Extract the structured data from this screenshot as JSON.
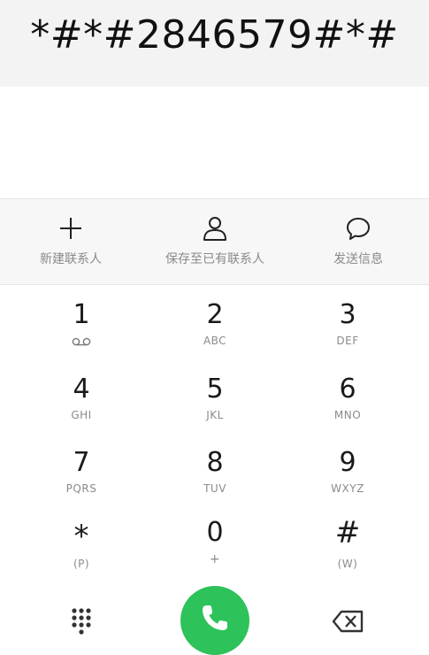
{
  "dialer": {
    "number": "*#*#2846579#*#"
  },
  "actions": [
    {
      "label": "新建联系人",
      "icon": "plus-icon"
    },
    {
      "label": "保存至已有联系人",
      "icon": "person-icon"
    },
    {
      "label": "发送信息",
      "icon": "message-bubble-icon"
    }
  ],
  "keys": [
    {
      "digit": "1",
      "letters": "",
      "icon": "voicemail-icon"
    },
    {
      "digit": "2",
      "letters": "ABC"
    },
    {
      "digit": "3",
      "letters": "DEF"
    },
    {
      "digit": "4",
      "letters": "GHI"
    },
    {
      "digit": "5",
      "letters": "JKL"
    },
    {
      "digit": "6",
      "letters": "MNO"
    },
    {
      "digit": "7",
      "letters": "PQRS"
    },
    {
      "digit": "8",
      "letters": "TUV"
    },
    {
      "digit": "9",
      "letters": "WXYZ"
    },
    {
      "digit": "*",
      "letters": "(P)"
    },
    {
      "digit": "0",
      "letters": "+"
    },
    {
      "digit": "#",
      "letters": "(W)"
    }
  ],
  "bottom": {
    "dialpad_icon": "dialpad-grid-icon",
    "call_icon": "phone-icon",
    "backspace_icon": "backspace-icon",
    "call_color": "#2dc25a"
  }
}
